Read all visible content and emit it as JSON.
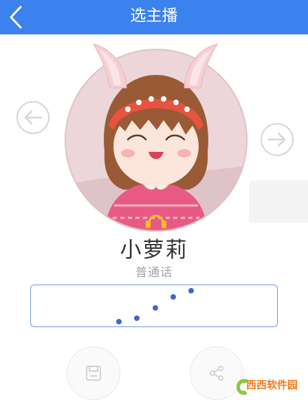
{
  "header": {
    "title": "选主播"
  },
  "nav": {
    "prev_icon": "arrow-left-icon",
    "next_icon": "arrow-right-icon"
  },
  "anchor": {
    "name": "小萝莉",
    "accent": "普通话",
    "speed_level": 0.8
  },
  "actions": {
    "save_icon": "save-icon",
    "share_icon": "share-icon"
  },
  "watermark": {
    "brand": "西西软件园",
    "sub": "CR173.COM"
  },
  "colors": {
    "header": "#3b82ee",
    "dot": "#4466cc",
    "box_border": "#6a99e6",
    "watermark_green": "#8cc63f",
    "watermark_orange": "#f27a1a"
  }
}
